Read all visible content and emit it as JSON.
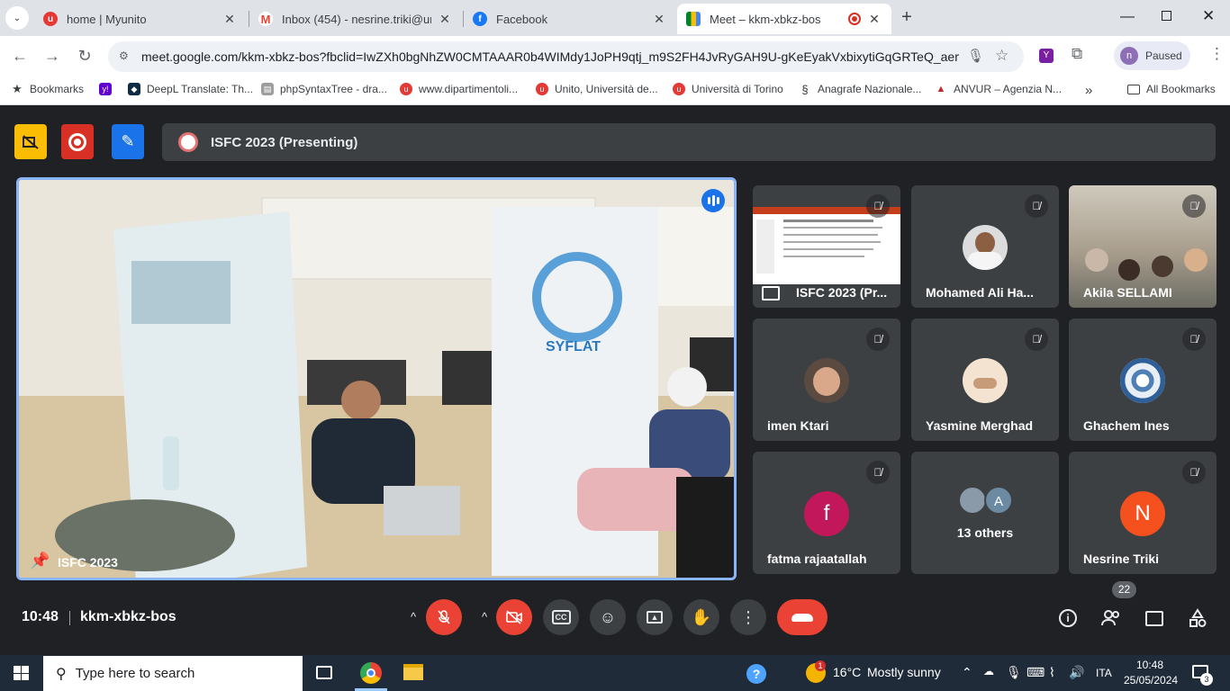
{
  "browser": {
    "tabs": [
      {
        "title": "home | Myunito"
      },
      {
        "title": "Inbox (454) - nesrine.triki@unit"
      },
      {
        "title": "Facebook"
      },
      {
        "title": "Meet – kkm-xbkz-bos"
      }
    ],
    "url": "meet.google.com/kkm-xbkz-bos?fbclid=IwZXh0bgNhZW0CMTAAAR0b4WIMdy1JoPH9qtj_m9S2FH4JvRyGAH9U-gKeEyakVxbixytiGqGRTeQ_aem_...",
    "profile_status": "Paused",
    "profile_initial": "n",
    "bookmarks": [
      "Bookmarks",
      "DeepL Translate: Th...",
      "phpSyntaxTree - dra...",
      "www.dipartimentoli...",
      "Unito, Università de...",
      "Università di Torino",
      "Anagrafe Nazionale...",
      "ANVUR – Agenzia N..."
    ],
    "all_bookmarks": "All Bookmarks"
  },
  "meet": {
    "presentation_title": "ISFC 2023 (Presenting)",
    "main_video_label": "ISFC 2023",
    "participants": [
      {
        "name": "ISFC 2023 (Pr...",
        "type": "screen"
      },
      {
        "name": "Mohamed Ali Ha...",
        "type": "photo"
      },
      {
        "name": "Akila SELLAMI",
        "type": "photo"
      },
      {
        "name": "imen Ktari",
        "type": "photo"
      },
      {
        "name": "Yasmine Merghad",
        "type": "photo"
      },
      {
        "name": "Ghachem Ines",
        "type": "photo"
      },
      {
        "name": "fatma rajaatallah",
        "type": "initial",
        "initial": "f",
        "color": "#c2185b"
      },
      {
        "name": "13 others",
        "type": "others",
        "initial": "A"
      },
      {
        "name": "Nesrine Triki",
        "type": "initial",
        "initial": "N",
        "color": "#f4511e"
      }
    ],
    "time": "10:48",
    "meeting_code": "kkm-xbkz-bos",
    "participant_count": "22"
  },
  "taskbar": {
    "search_placeholder": "Type here to search",
    "weather_temp": "16°C",
    "weather_text": "Mostly sunny",
    "language": "ITA",
    "clock_time": "10:48",
    "clock_date": "25/05/2024",
    "notifications": "3",
    "weather_badge": "1"
  },
  "colors": {
    "accent_blue": "#8ab4f8",
    "end_call_red": "#ea4335",
    "meet_bg": "#202124",
    "tile_bg": "#3c4043"
  }
}
